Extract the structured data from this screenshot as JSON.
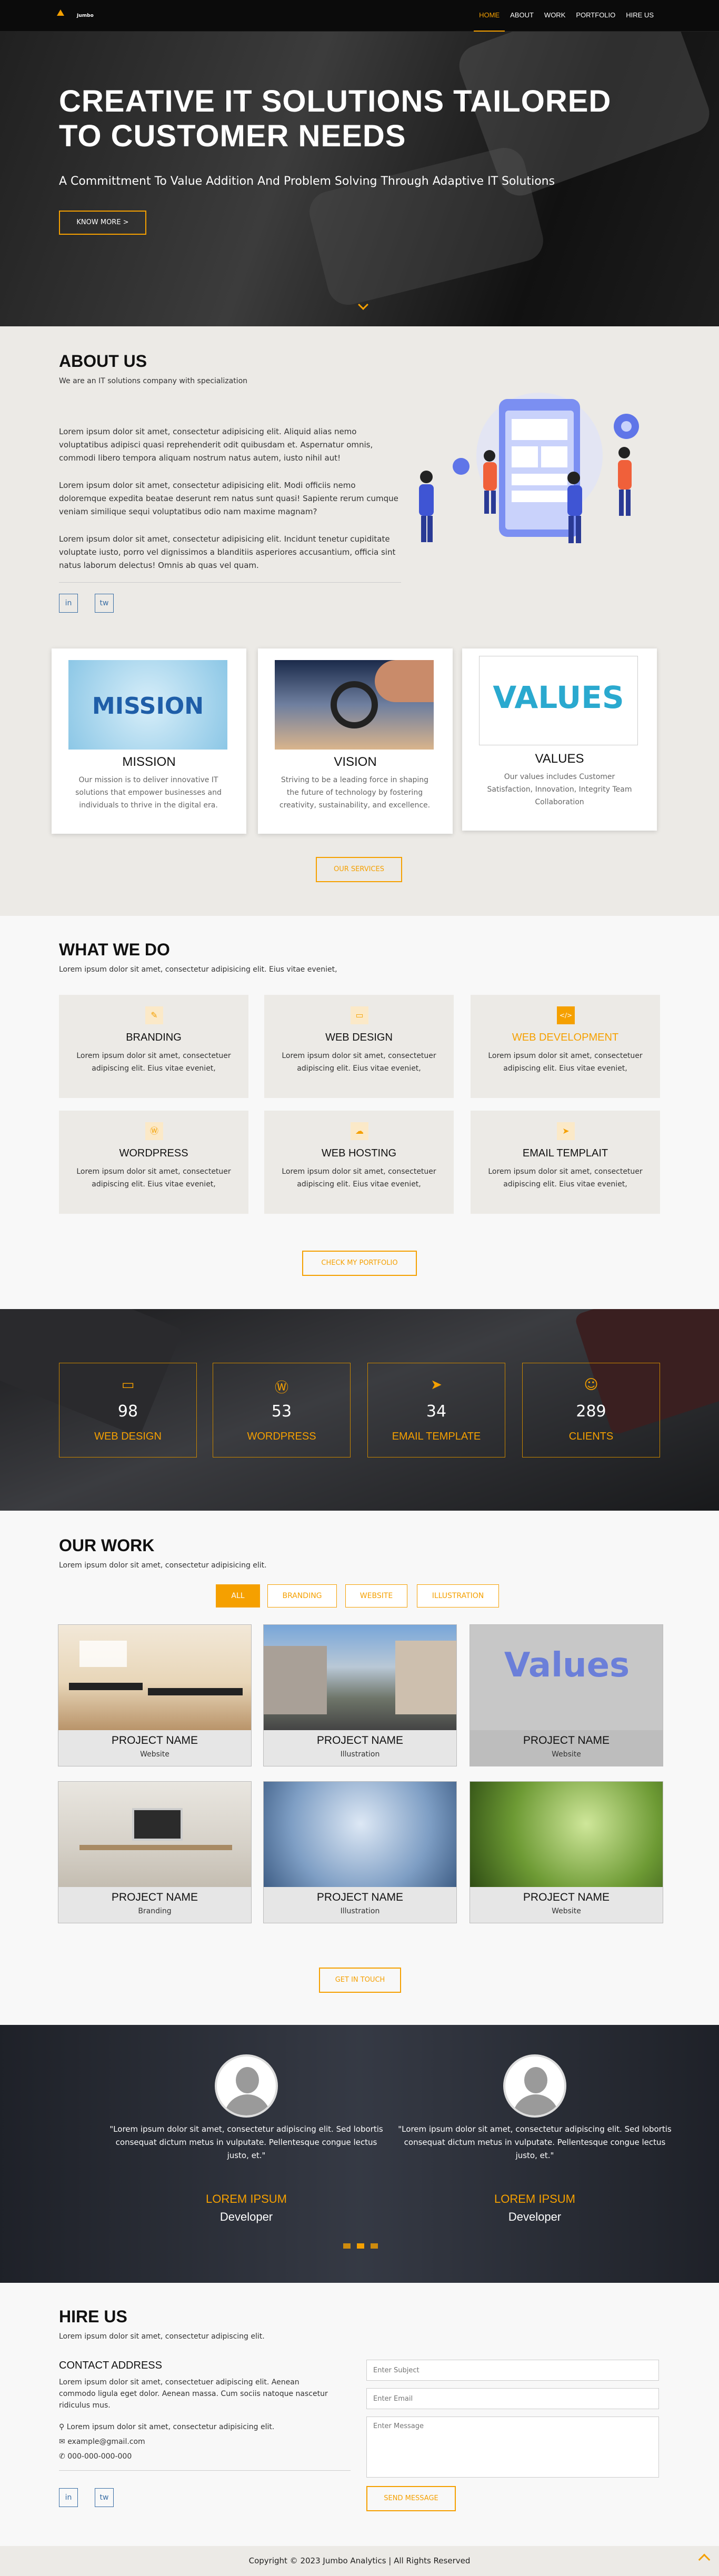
{
  "nav": {
    "logo_text": "Jumbo",
    "items": [
      "HOME",
      "ABOUT",
      "WORK",
      "PORTFOLIO",
      "HIRE US"
    ],
    "active": "HOME"
  },
  "hero": {
    "title": "CREATIVE IT SOLUTIONS TAILORED TO CUSTOMER NEEDS",
    "subtitle": "A Committment To Value Addition And Problem Solving Through Adaptive IT Solutions",
    "button": "KNOW MORE  >",
    "scroll_icon": "chevron-down-icon"
  },
  "about": {
    "title": "ABOUT US",
    "subtitle": "We are an IT solutions company with specialization",
    "paragraphs": [
      "Lorem ipsum dolor sit amet, consectetur adipisicing elit. Aliquid alias nemo voluptatibus adipisci quasi reprehenderit odit quibusdam et. Aspernatur omnis, commodi libero tempora aliquam nostrum natus autem, iusto nihil aut!",
      "Lorem ipsum dolor sit amet, consectetur adipisicing elit. Modi officiis nemo doloremque expedita beatae deserunt rem natus sunt quasi! Sapiente rerum cumque veniam similique sequi voluptatibus odio nam maxime magnam?",
      "Lorem ipsum dolor sit amet, consectetur adipisicing elit. Incidunt tenetur cupiditate voluptate iusto, porro vel dignissimos a blanditiis asperiores accusantium, officia sint natus laborum delectus! Omnis ab quas vel quam."
    ],
    "social": [
      "in",
      "tw"
    ],
    "cards": [
      {
        "image_text": "MISSION",
        "title": "MISSION",
        "text": "Our mission is to deliver innovative IT solutions that empower businesses and individuals to thrive in the digital era."
      },
      {
        "title": "VISION",
        "text": "Striving to be a leading force in shaping the future of technology by fostering creativity, sustainability, and excellence."
      },
      {
        "image_text": "VALUES",
        "title": "VALUES",
        "text": "Our values includes Customer Satisfaction, Innovation, Integrity Team Collaboration"
      }
    ],
    "button": "OUR SERVICES"
  },
  "services": {
    "title": "WHAT WE DO",
    "subtitle": "Lorem ipsum dolor sit amet, consectetur adipisicing elit. Eius vitae eveniet,",
    "items": [
      {
        "icon": "pencil-icon",
        "glyph": "✎",
        "title": "BRANDING",
        "text": "Lorem ipsum dolor sit amet, consectetuer adipiscing elit. Eius vitae eveniet,"
      },
      {
        "icon": "monitor-icon",
        "glyph": "▭",
        "title": "WEB DESIGN",
        "text": "Lorem ipsum dolor sit amet, consectetuer adipiscing elit. Eius vitae eveniet,"
      },
      {
        "icon": "code-icon",
        "glyph": "</>",
        "title": "WEB DEVELOPMENT",
        "text": "Lorem ipsum dolor sit amet, consectetuer adipiscing elit. Eius vitae eveniet,"
      },
      {
        "icon": "wordpress-icon",
        "glyph": "Ⓦ",
        "title": "WORDPRESS",
        "text": "Lorem ipsum dolor sit amet, consectetuer adipiscing elit. Eius vitae eveniet,"
      },
      {
        "icon": "cloud-icon",
        "glyph": "☁",
        "title": "WEB HOSTING",
        "text": "Lorem ipsum dolor sit amet, consectetuer adipiscing elit. Eius vitae eveniet,"
      },
      {
        "icon": "paper-plane-icon",
        "glyph": "➤",
        "title": "EMAIL TEMPLAIT",
        "text": "Lorem ipsum dolor sit amet, consectetuer adipiscing elit. Eius vitae eveniet,"
      }
    ],
    "highlight_index": 2,
    "button": "CHECK MY PORTFOLIO"
  },
  "stats": [
    {
      "icon": "monitor-icon",
      "glyph": "▭",
      "value": "98",
      "label": "WEB DESIGN"
    },
    {
      "icon": "wordpress-icon",
      "glyph": "Ⓦ",
      "value": "53",
      "label": "WORDPRESS"
    },
    {
      "icon": "paper-plane-icon",
      "glyph": "➤",
      "value": "34",
      "label": "EMAIL TEMPLATE"
    },
    {
      "icon": "smile-icon",
      "glyph": "☺",
      "value": "289",
      "label": "CLIENTS"
    }
  ],
  "work": {
    "title": "OUR WORK",
    "subtitle": "Lorem ipsum dolor sit amet, consectetur adipisicing elit.",
    "filters": [
      "ALL",
      "BRANDING",
      "WEBSITE",
      "ILLUSTRATION"
    ],
    "active_filter": "ALL",
    "projects": [
      {
        "name": "PROJECT NAME",
        "category": "Website"
      },
      {
        "name": "PROJECT NAME",
        "category": "Illustration"
      },
      {
        "name": "PROJECT NAME",
        "category": "Website",
        "image_text": "Values"
      },
      {
        "name": "PROJECT NAME",
        "category": "Branding"
      },
      {
        "name": "PROJECT NAME",
        "category": "Illustration"
      },
      {
        "name": "PROJECT NAME",
        "category": "Website"
      }
    ],
    "button": "GET IN TOUCH"
  },
  "testimonials": {
    "items": [
      {
        "quote": "\"Lorem ipsum dolor sit amet, consectetur adipiscing elit. Sed lobortis consequat dictum metus in vulputate. Pellentesque congue lectus justo, et.\"",
        "name": "LOREM IPSUM",
        "role": "Developer"
      },
      {
        "quote": "\"Lorem ipsum dolor sit amet, consectetur adipiscing elit. Sed lobortis consequat dictum metus in vulputate. Pellentesque congue lectus justo, et.\"",
        "name": "LOREM IPSUM",
        "role": "Developer"
      }
    ]
  },
  "hire": {
    "title": "HIRE US",
    "subtitle": "Lorem ipsum dolor sit amet, consectetur adipiscing elit.",
    "contact_title": "CONTACT ADDRESS",
    "contact_text": "Lorem ipsum dolor sit amet, consectetuer adipiscing elit. Aenean commodo ligula eget dolor. Aenean massa. Cum sociis natoque nascetur ridiculus mus.",
    "address": "Lorem ipsum dolor sit amet, consectetur adipisicing elit.",
    "email": "example@gmail.com",
    "phone": "000-000-000-000",
    "placeholders": {
      "subject": "Enter Subject",
      "email": "Enter Email",
      "message": "Enter Message"
    },
    "button": "SEND MESSAGE"
  },
  "footer": {
    "text": "Copyright © 2023 Jumbo Analytics | All Rights Reserved"
  },
  "colors": {
    "accent": "#f5a000",
    "dark": "#0b0b0b",
    "light_bg": "#eceae6"
  }
}
